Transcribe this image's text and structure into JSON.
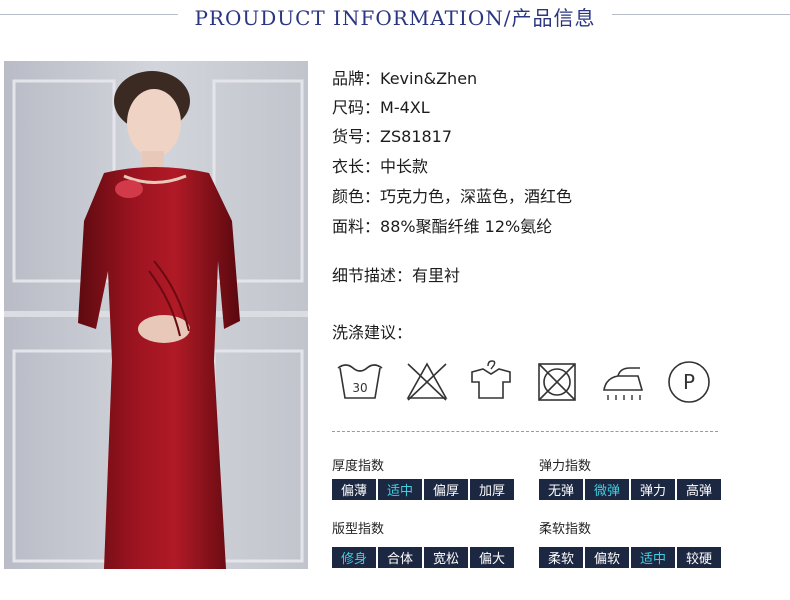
{
  "header": {
    "title": "PROUDUCT INFORMATION/产品信息"
  },
  "specs": [
    {
      "key": "品牌：",
      "value": "Kevin&Zhen"
    },
    {
      "key": "尺码：",
      "value": "M-4XL"
    },
    {
      "key": "货号：",
      "value": "ZS81817"
    },
    {
      "key": "衣长：",
      "value": "中长款"
    },
    {
      "key": "颜色：",
      "value": "巧克力色，深蓝色，酒红色"
    },
    {
      "key": "面料：",
      "value": "88%聚酯纤维 12%氨纶"
    }
  ],
  "detail": {
    "key": "细节描述：",
    "value": "有里衬"
  },
  "care": {
    "title": "洗涤建议：",
    "wash_temp": "30",
    "icons": [
      "hand-wash-30-icon",
      "no-bleach-icon",
      "hang-dry-icon",
      "no-tumble-dry-icon",
      "iron-icon",
      "dry-clean-p-icon"
    ],
    "dry_clean_letter": "P"
  },
  "indices": {
    "thickness": {
      "title": "厚度指数",
      "options": [
        "偏薄",
        "适中",
        "偏厚",
        "加厚"
      ],
      "selected": 1
    },
    "elasticity": {
      "title": "弹力指数",
      "options": [
        "无弹",
        "微弹",
        "弹力",
        "高弹"
      ],
      "selected": 1
    },
    "fit": {
      "title": "版型指数",
      "options": [
        "修身",
        "合体",
        "宽松",
        "偏大"
      ],
      "selected": 0
    },
    "softness": {
      "title": "柔软指数",
      "options": [
        "柔软",
        "偏软",
        "适中",
        "较硬"
      ],
      "selected": 2
    }
  },
  "colors": {
    "accent": "#2b3680",
    "chip_bg": "#1c2742",
    "chip_selected_text": "#3fd0e0",
    "dress": "#8a1018"
  }
}
